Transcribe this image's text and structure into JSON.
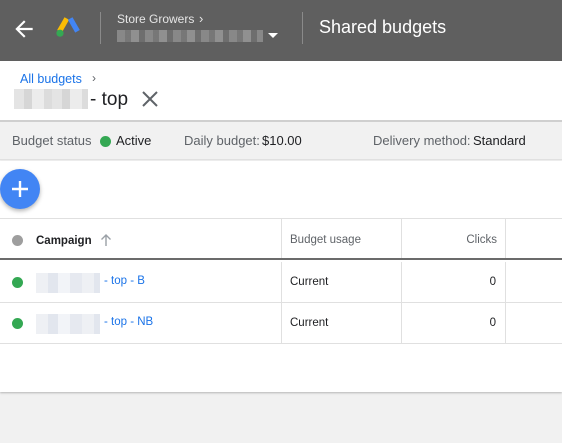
{
  "header": {
    "account_label": "Store Growers",
    "account_chevron": "›",
    "page_title": "Shared budgets"
  },
  "breadcrumb": {
    "all_budgets": "All budgets",
    "chevron": "›"
  },
  "budget": {
    "name_suffix": "- top"
  },
  "status": {
    "budget_status_label": "Budget status",
    "budget_status_value": "Active",
    "daily_budget_label": "Daily budget:",
    "daily_budget_value": "$10.00",
    "delivery_label": "Delivery method:",
    "delivery_value": "Standard"
  },
  "table": {
    "headers": {
      "campaign": "Campaign",
      "budget_usage": "Budget usage",
      "clicks": "Clicks"
    },
    "rows": [
      {
        "campaign_suffix": "- top - B",
        "budget_usage": "Current",
        "clicks": "0"
      },
      {
        "campaign_suffix": "- top - NB",
        "budget_usage": "Current",
        "clicks": "0"
      }
    ]
  },
  "colors": {
    "header_bg": "#5f5f5f",
    "accent": "#1a73e8",
    "fab": "#4285f4",
    "active": "#34a853"
  },
  "icons": [
    "arrow-back-icon",
    "google-ads-logo",
    "caret-down-icon",
    "close-icon",
    "add-icon",
    "sort-arrow-icon",
    "status-dot-icon"
  ]
}
